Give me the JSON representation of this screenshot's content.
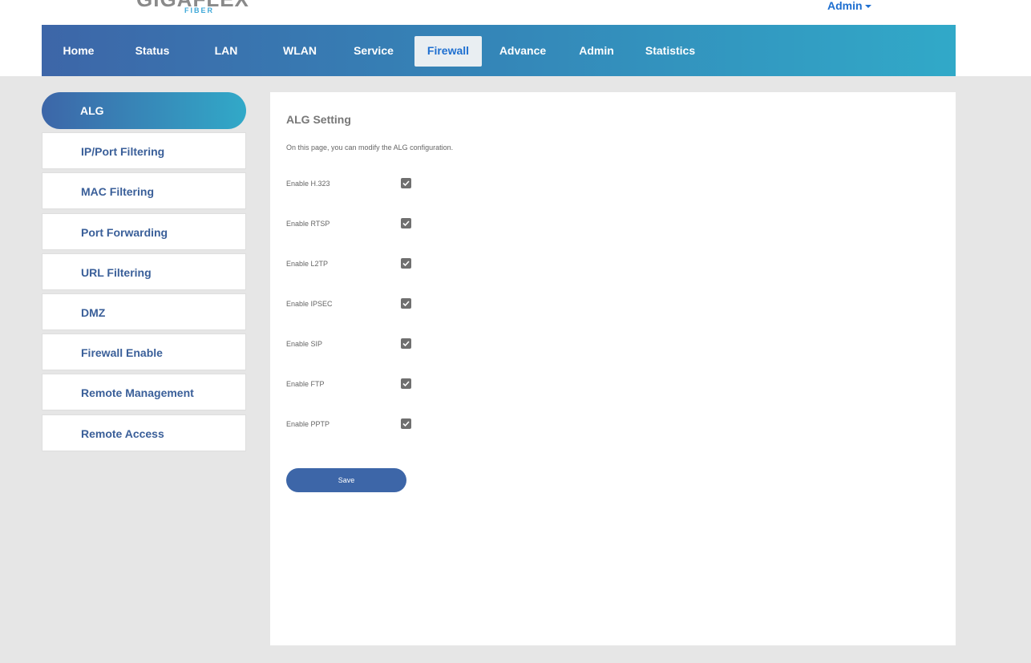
{
  "brand": {
    "name": "GIGAFLEX",
    "sub": "FIBER"
  },
  "user_menu": {
    "label": "Admin"
  },
  "nav": [
    {
      "label": "Home"
    },
    {
      "label": "Status"
    },
    {
      "label": "LAN"
    },
    {
      "label": "WLAN"
    },
    {
      "label": "Service"
    },
    {
      "label": "Firewall",
      "active": true
    },
    {
      "label": "Advance"
    },
    {
      "label": "Admin"
    },
    {
      "label": "Statistics"
    }
  ],
  "sidebar": {
    "items": [
      {
        "label": "ALG",
        "active": true
      },
      {
        "label": "IP/Port Filtering"
      },
      {
        "label": "MAC Filtering"
      },
      {
        "label": "Port Forwarding"
      },
      {
        "label": "URL Filtering"
      },
      {
        "label": "DMZ"
      },
      {
        "label": "Firewall Enable"
      },
      {
        "label": "Remote Management"
      },
      {
        "label": "Remote Access"
      }
    ]
  },
  "main": {
    "title": "ALG Setting",
    "description": "On this page, you can modify the ALG configuration.",
    "options": [
      {
        "label": "Enable H.323",
        "checked": true
      },
      {
        "label": "Enable RTSP",
        "checked": true
      },
      {
        "label": "Enable L2TP",
        "checked": true
      },
      {
        "label": "Enable IPSEC",
        "checked": true
      },
      {
        "label": "Enable SIP",
        "checked": true
      },
      {
        "label": "Enable FTP",
        "checked": true
      },
      {
        "label": "Enable PPTP",
        "checked": true
      }
    ],
    "save_label": "Save"
  },
  "colors": {
    "nav_start": "#3d66a8",
    "nav_end": "#31a9c8",
    "accent_blue": "#1e6fd0",
    "sidebar_text": "#3a5f99",
    "checkbox": "#6f6f6f",
    "page_bg": "#e6e6e6"
  },
  "icons": {
    "checkbox_check": "check-icon",
    "admin_caret": "caret-down-icon"
  }
}
